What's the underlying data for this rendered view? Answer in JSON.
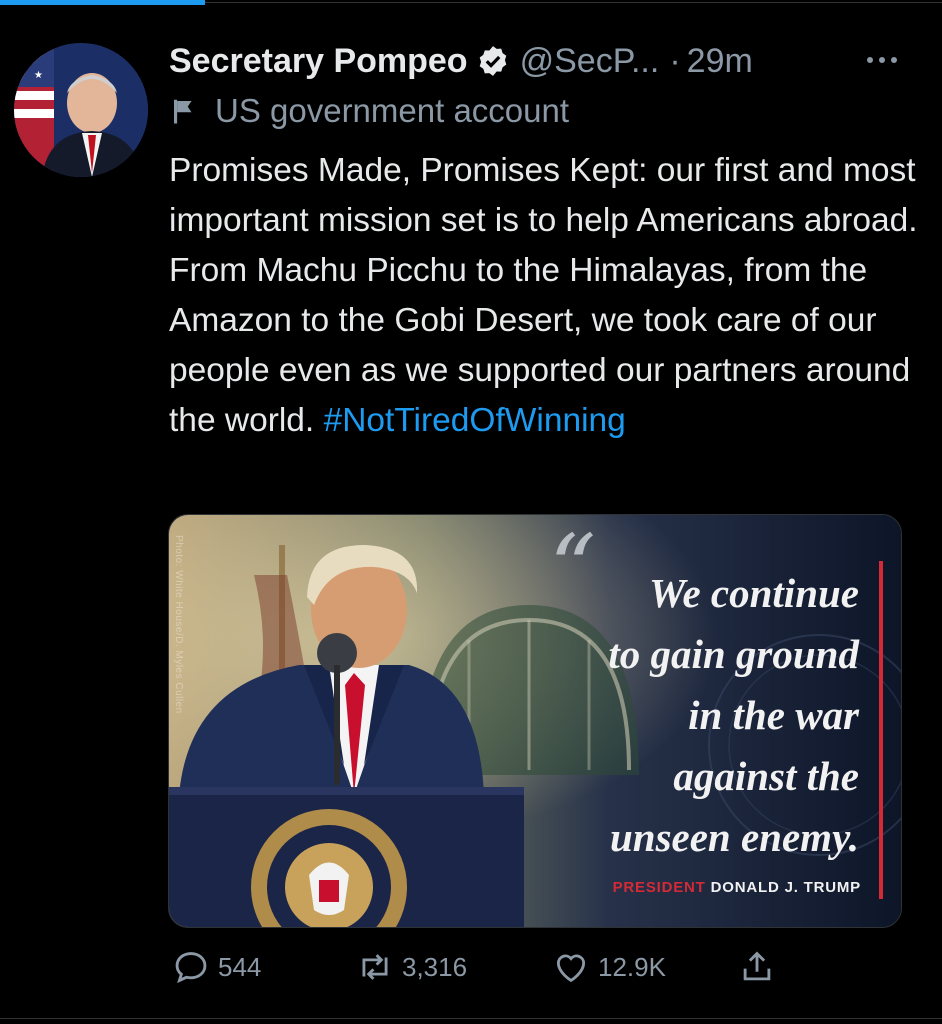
{
  "colors": {
    "background": "#000000",
    "accent": "#1d9bf0",
    "muted": "#8b98a5",
    "quote_red": "#d42a36"
  },
  "tweet": {
    "author_name": "Secretary Pompeo",
    "handle": "@SecP...",
    "separator": "·",
    "time": "29m",
    "govt_label": "US government account",
    "text": "Promises Made, Promises Kept: our first and most important mission set is to help Americans abroad. From Machu Picchu to the Himalayas, from the Amazon to the Gobi Desert, we took care of our people even as we supported our partners around the world.",
    "hashtag": "#NotTiredOfWinning"
  },
  "media": {
    "credit": "Photo: White House/D. Myles Cullen",
    "quote_mark": "“",
    "quote_lines": [
      "We continue",
      "to gain ground",
      "in the war",
      "against the",
      "unseen enemy."
    ],
    "attribution_title": "PRESIDENT",
    "attribution_name": "DONALD J. TRUMP"
  },
  "actions": {
    "reply_count": "544",
    "retweet_count": "3,316",
    "like_count": "12.9K"
  },
  "icons": [
    "verified-icon",
    "more-icon",
    "flag-icon",
    "reply-icon",
    "retweet-icon",
    "like-icon",
    "share-icon"
  ]
}
